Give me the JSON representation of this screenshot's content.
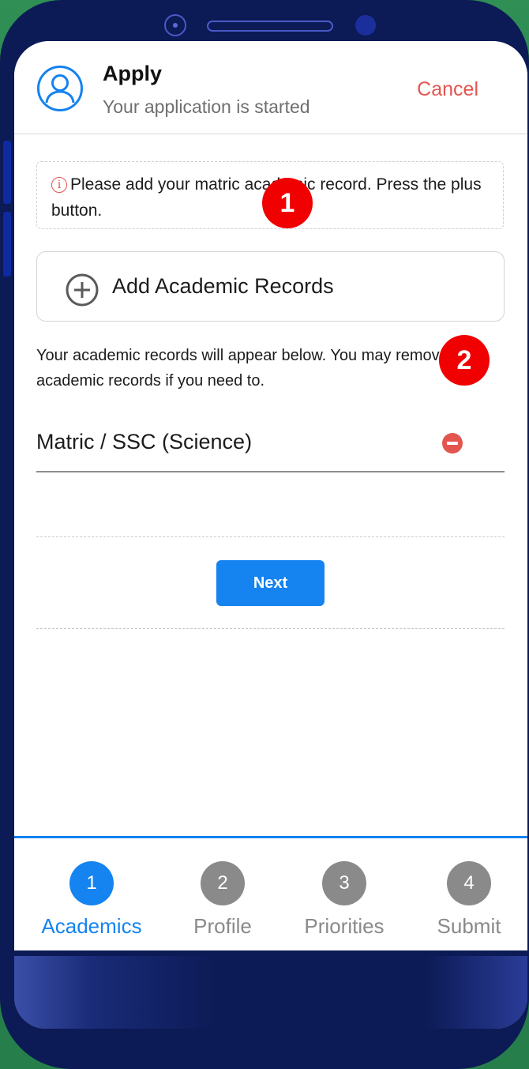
{
  "header": {
    "title": "Apply",
    "subtitle": "Your application is started",
    "cancel_label": "Cancel"
  },
  "notice": {
    "icon": "info-icon",
    "text": "Please add your matric academic record. Press the plus button."
  },
  "add_button": {
    "label": "Add Academic Records",
    "icon": "plus-circle-icon"
  },
  "help_text": "Your academic records will appear below. You may remove the academic records if you need to.",
  "records": [
    {
      "label": "Matric / SSC (Science)",
      "action_icon": "remove-circle-icon"
    }
  ],
  "next_label": "Next",
  "callouts": [
    "1",
    "2"
  ],
  "steps": [
    {
      "number": "1",
      "label": "Academics",
      "active": true
    },
    {
      "number": "2",
      "label": "Profile",
      "active": false
    },
    {
      "number": "3",
      "label": "Priorities",
      "active": false
    },
    {
      "number": "4",
      "label": "Submit",
      "active": false
    }
  ],
  "colors": {
    "primary": "#1583f0",
    "cancel": "#e2564f",
    "remove": "#e2564f",
    "callout": "#f00000",
    "inactive_step": "#8a8a8a",
    "phone_body": "#0c1a55",
    "background": "#2a8a4e"
  }
}
